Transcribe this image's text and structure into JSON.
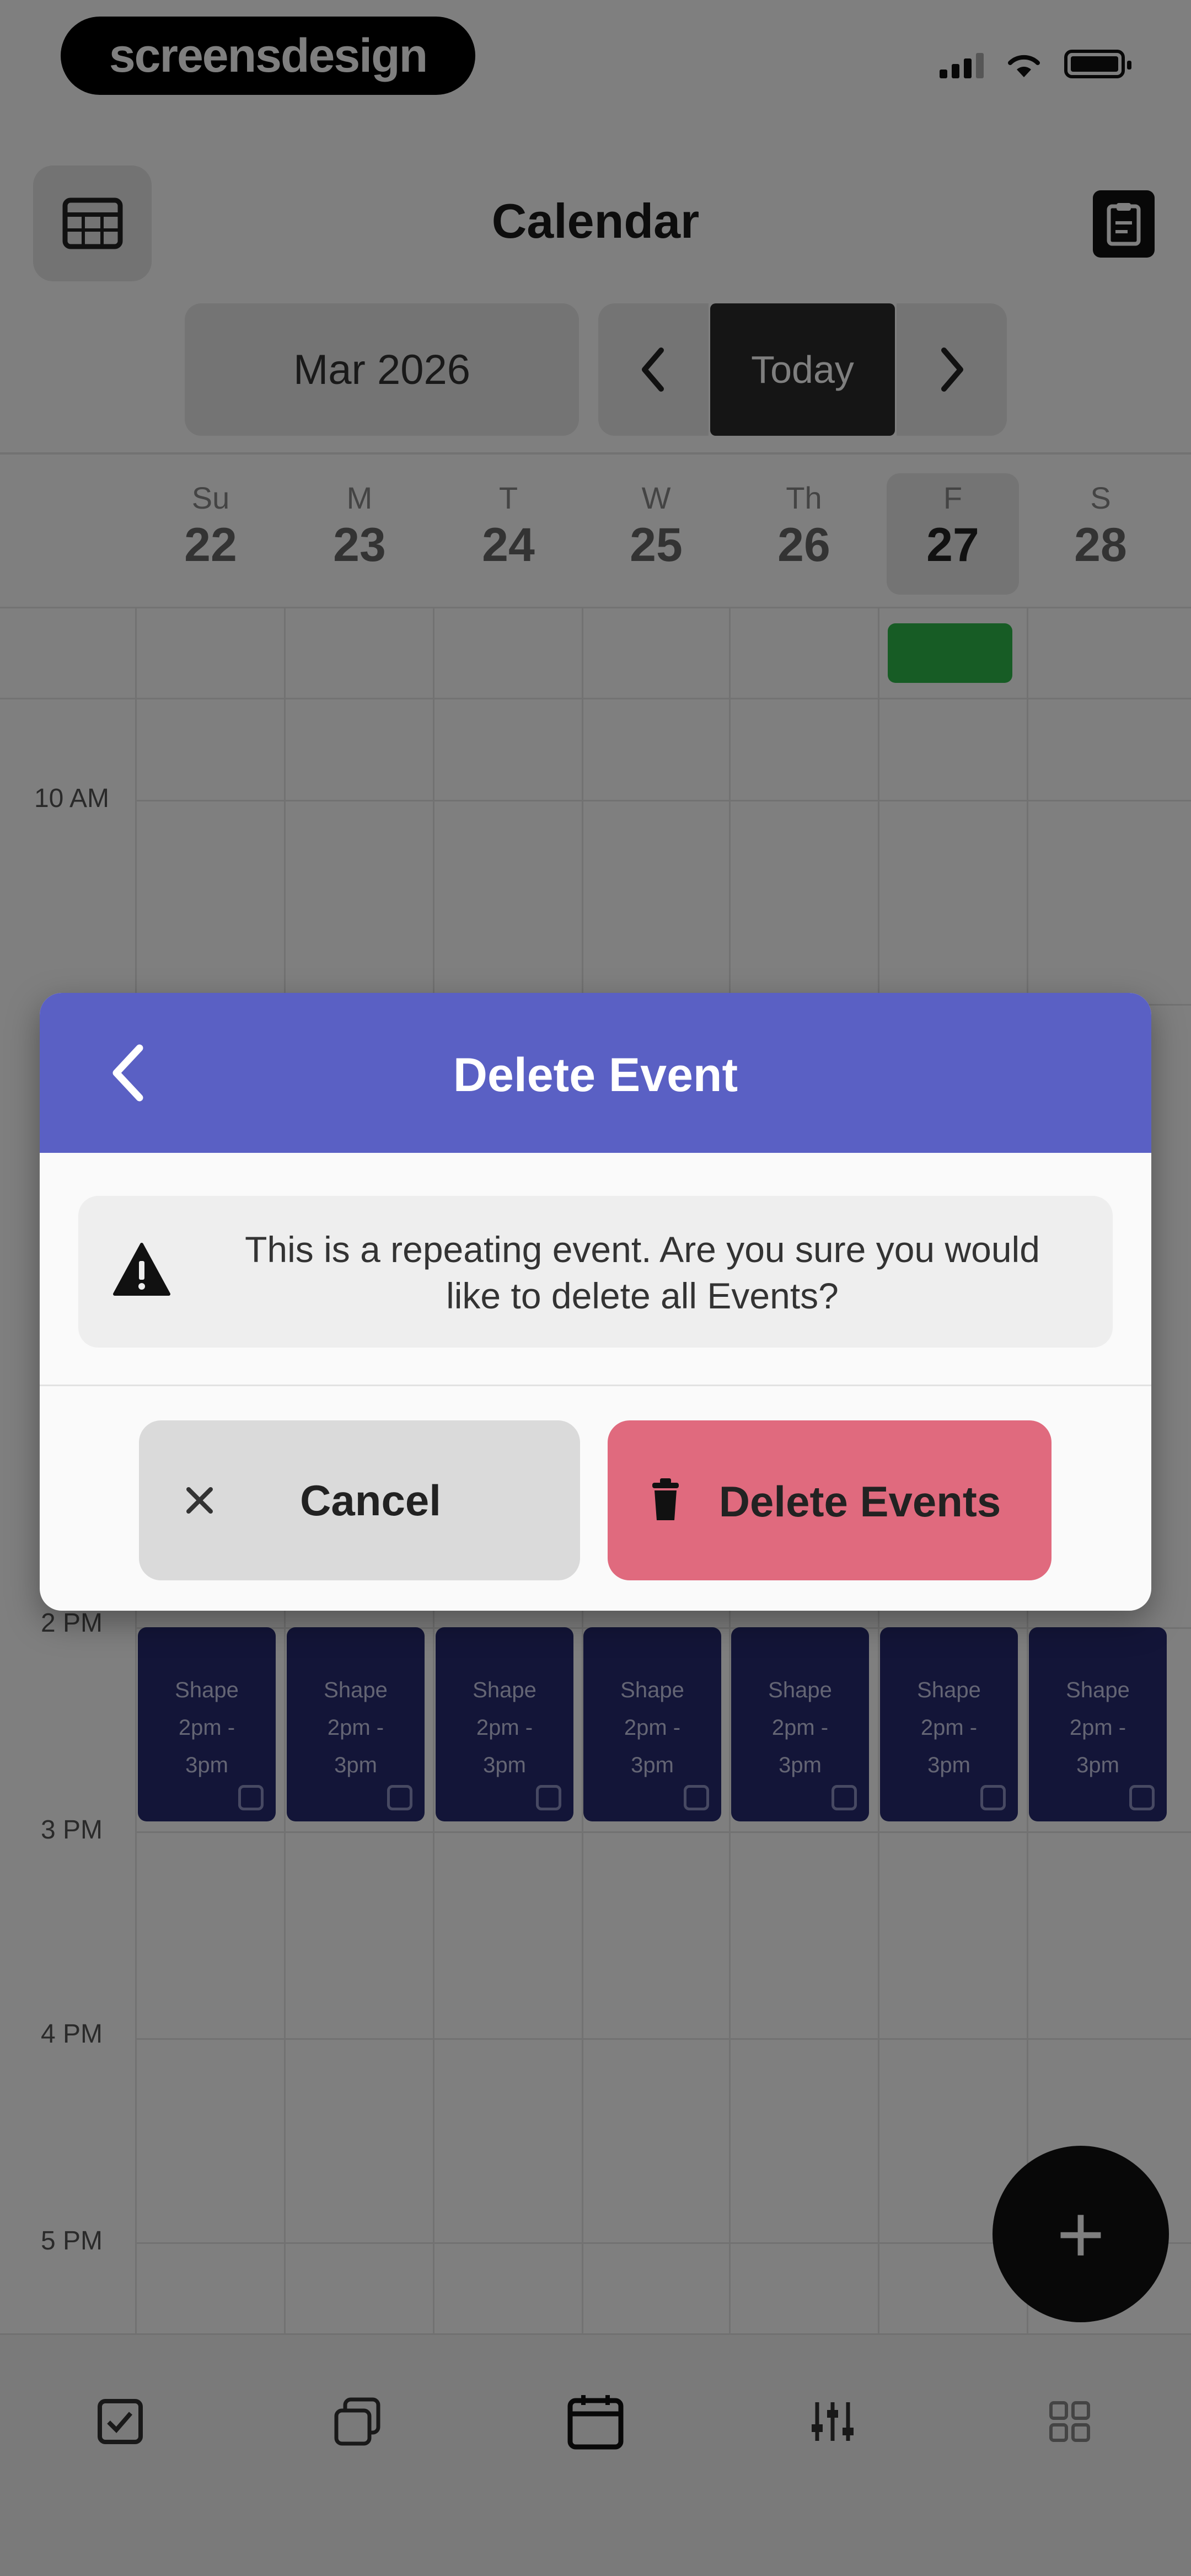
{
  "status_bar": {
    "watermark": "screensdesign"
  },
  "header": {
    "title": "Calendar",
    "left_icon": "calendar-grid-icon",
    "right_icon": "clipboard-icon"
  },
  "toolbar": {
    "month_label": "Mar 2026",
    "prev_icon": "chevron-left-icon",
    "today_label": "Today",
    "next_icon": "chevron-right-icon"
  },
  "week": {
    "days": [
      {
        "name": "Su",
        "date": "22"
      },
      {
        "name": "M",
        "date": "23"
      },
      {
        "name": "T",
        "date": "24"
      },
      {
        "name": "W",
        "date": "25"
      },
      {
        "name": "Th",
        "date": "26"
      },
      {
        "name": "F",
        "date": "27"
      },
      {
        "name": "S",
        "date": "28"
      }
    ],
    "selected_day": "27"
  },
  "times": [
    "10 AM",
    "2 PM",
    "3 PM",
    "4 PM",
    "5 PM"
  ],
  "events": [
    {
      "title": "Shape",
      "line2": "2pm -",
      "line3": "3pm"
    },
    {
      "title": "Shape",
      "line2": "2pm -",
      "line3": "3pm"
    },
    {
      "title": "Shape",
      "line2": "2pm -",
      "line3": "3pm"
    },
    {
      "title": "Shape",
      "line2": "2pm -",
      "line3": "3pm"
    },
    {
      "title": "Shape",
      "line2": "2pm -",
      "line3": "3pm"
    },
    {
      "title": "Shape",
      "line2": "2pm -",
      "line3": "3pm"
    },
    {
      "title": "Shape",
      "line2": "2pm -",
      "line3": "3pm"
    }
  ],
  "fab": {
    "label": "+"
  },
  "modal": {
    "title": "Delete Event",
    "message": "This is a repeating event. Are you sure you would like to delete all Events?",
    "cancel_label": "Cancel",
    "delete_label": "Delete Events"
  },
  "bottom_nav": {
    "items": [
      "checklist-icon",
      "layers-icon",
      "calendar-icon",
      "sliders-icon",
      "grid-icon"
    ],
    "active": "calendar-icon"
  },
  "colors": {
    "modal_header": "#5a60c4",
    "delete_button": "#e06a7e",
    "event_fill": "#262b70",
    "status_chip": "#2eb84a"
  }
}
